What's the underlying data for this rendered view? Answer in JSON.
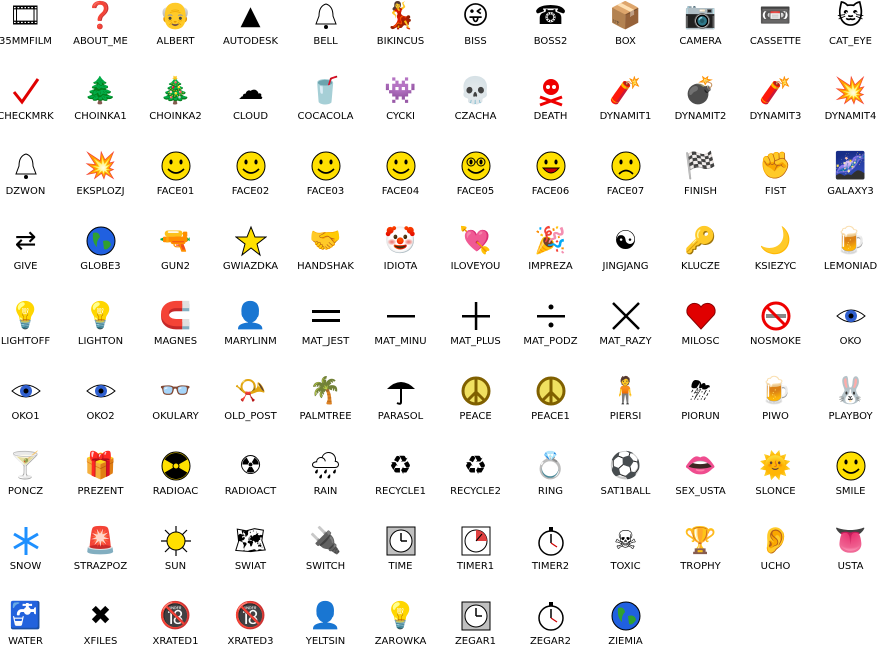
{
  "items": [
    {
      "label": "35MMFILM",
      "icon": "film-canister-icon"
    },
    {
      "label": "ABOUT_ME",
      "icon": "question-mark-icon"
    },
    {
      "label": "ALBERT",
      "icon": "einstein-portrait-icon"
    },
    {
      "label": "AUTODESK",
      "icon": "autodesk-logo-icon"
    },
    {
      "label": "BELL",
      "icon": "bell-icon"
    },
    {
      "label": "BIKINCUS",
      "icon": "bikini-woman-icon"
    },
    {
      "label": "BISS",
      "icon": "cartoon-face-icon"
    },
    {
      "label": "BOSS2",
      "icon": "boss-phone-icon"
    },
    {
      "label": "BOX",
      "icon": "box-icon"
    },
    {
      "label": "CAMERA",
      "icon": "camera-icon"
    },
    {
      "label": "CASSETTE",
      "icon": "cassette-icon"
    },
    {
      "label": "CAT_EYE",
      "icon": "cat-eye-icon"
    },
    {
      "label": "CHECKMRK",
      "icon": "checkmark-icon"
    },
    {
      "label": "CHOINKA1",
      "icon": "christmas-tree-icon"
    },
    {
      "label": "CHOINKA2",
      "icon": "decorated-christmas-tree-icon"
    },
    {
      "label": "CLOUD",
      "icon": "cloud-icon"
    },
    {
      "label": "COCACOLA",
      "icon": "cola-can-icon"
    },
    {
      "label": "CYCKI",
      "icon": "cartoon-creature-icon"
    },
    {
      "label": "CZACHA",
      "icon": "skull-icon"
    },
    {
      "label": "DEATH",
      "icon": "skull-crossbones-icon"
    },
    {
      "label": "DYNAMIT1",
      "icon": "dynamite-icon"
    },
    {
      "label": "DYNAMIT2",
      "icon": "detonator-icon"
    },
    {
      "label": "DYNAMIT3",
      "icon": "dynamite-stick-icon"
    },
    {
      "label": "DYNAMIT4",
      "icon": "dynamite-bundle-icon"
    },
    {
      "label": "DZWON",
      "icon": "bell-icon"
    },
    {
      "label": "EKSPLOZJ",
      "icon": "explosion-icon"
    },
    {
      "label": "FACE01",
      "icon": "smiley-face-icon"
    },
    {
      "label": "FACE02",
      "icon": "smiley-face-icon"
    },
    {
      "label": "FACE03",
      "icon": "smiley-face-icon"
    },
    {
      "label": "FACE04",
      "icon": "smiley-face-icon"
    },
    {
      "label": "FACE05",
      "icon": "glasses-face-icon"
    },
    {
      "label": "FACE06",
      "icon": "laughing-face-icon"
    },
    {
      "label": "FACE07",
      "icon": "sad-face-icon"
    },
    {
      "label": "FINISH",
      "icon": "checkered-flag-icon"
    },
    {
      "label": "FIST",
      "icon": "fist-icon"
    },
    {
      "label": "GALAXY3",
      "icon": "galaxy-icon"
    },
    {
      "label": "GIVE",
      "icon": "give-arrows-icon"
    },
    {
      "label": "GLOBE3",
      "icon": "globe-icon"
    },
    {
      "label": "GUN2",
      "icon": "gun-icon"
    },
    {
      "label": "GWIAZDKA",
      "icon": "star-icon"
    },
    {
      "label": "HANDSHAK",
      "icon": "handshake-icon"
    },
    {
      "label": "IDIOTA",
      "icon": "jester-icon"
    },
    {
      "label": "ILOVEYOU",
      "icon": "heart-arrow-icon"
    },
    {
      "label": "IMPREZA",
      "icon": "party-icon"
    },
    {
      "label": "JINGJANG",
      "icon": "yin-yang-icon"
    },
    {
      "label": "KLUCZE",
      "icon": "keys-icon"
    },
    {
      "label": "KSIEZYC",
      "icon": "moon-icon"
    },
    {
      "label": "LEMONIAD",
      "icon": "lemonade-icon"
    },
    {
      "label": "LIGHTOFF",
      "icon": "lightbulb-off-icon"
    },
    {
      "label": "LIGHTON",
      "icon": "lightbulb-on-icon"
    },
    {
      "label": "MAGNES",
      "icon": "magnet-icon"
    },
    {
      "label": "MARYLINM",
      "icon": "portrait-icon"
    },
    {
      "label": "MAT_JEST",
      "icon": "equals-icon"
    },
    {
      "label": "MAT_MINU",
      "icon": "minus-icon"
    },
    {
      "label": "MAT_PLUS",
      "icon": "plus-icon"
    },
    {
      "label": "MAT_PODZ",
      "icon": "divide-icon"
    },
    {
      "label": "MAT_RAZY",
      "icon": "multiply-icon"
    },
    {
      "label": "MILOSC",
      "icon": "heart-icon"
    },
    {
      "label": "NOSMOKE",
      "icon": "no-smoking-icon"
    },
    {
      "label": "OKO",
      "icon": "eye-icon"
    },
    {
      "label": "OKO1",
      "icon": "eye-icon"
    },
    {
      "label": "OKO2",
      "icon": "eye-icon"
    },
    {
      "label": "OKULARY",
      "icon": "glasses-icon"
    },
    {
      "label": "OLD_POST",
      "icon": "post-horn-icon"
    },
    {
      "label": "PALMTREE",
      "icon": "palm-tree-icon"
    },
    {
      "label": "PARASOL",
      "icon": "umbrella-icon"
    },
    {
      "label": "PEACE",
      "icon": "peace-sign-icon"
    },
    {
      "label": "PEACE1",
      "icon": "peace-sign-icon"
    },
    {
      "label": "PIERSI",
      "icon": "torso-icon"
    },
    {
      "label": "PIORUN",
      "icon": "thunder-cloud-icon"
    },
    {
      "label": "PIWO",
      "icon": "beer-can-icon"
    },
    {
      "label": "PLAYBOY",
      "icon": "bunny-logo-icon"
    },
    {
      "label": "PONCZ",
      "icon": "cocktail-icon"
    },
    {
      "label": "PREZENT",
      "icon": "gift-icon"
    },
    {
      "label": "RADIOAC",
      "icon": "radioactive-icon"
    },
    {
      "label": "RADIOACT",
      "icon": "radioactive-barrel-icon"
    },
    {
      "label": "RAIN",
      "icon": "rain-cloud-icon"
    },
    {
      "label": "RECYCLE1",
      "icon": "recycle-icon"
    },
    {
      "label": "RECYCLE2",
      "icon": "recycle-icon"
    },
    {
      "label": "RING",
      "icon": "ring-icon"
    },
    {
      "label": "SAT1BALL",
      "icon": "ball-icon"
    },
    {
      "label": "SEX_USTA",
      "icon": "lips-icon"
    },
    {
      "label": "SLONCE",
      "icon": "sun-face-icon"
    },
    {
      "label": "SMILE",
      "icon": "smiley-face-icon"
    },
    {
      "label": "SNOW",
      "icon": "snowflake-icon"
    },
    {
      "label": "STRAZPOZ",
      "icon": "siren-icon"
    },
    {
      "label": "SUN",
      "icon": "sun-icon"
    },
    {
      "label": "SWIAT",
      "icon": "world-map-icon"
    },
    {
      "label": "SWITCH",
      "icon": "light-switch-icon"
    },
    {
      "label": "TIME",
      "icon": "clock-icon"
    },
    {
      "label": "TIMER1",
      "icon": "timer-icon"
    },
    {
      "label": "TIMER2",
      "icon": "stopwatch-icon"
    },
    {
      "label": "TOXIC",
      "icon": "toxic-icon"
    },
    {
      "label": "TROPHY",
      "icon": "trophy-icon"
    },
    {
      "label": "UCHO",
      "icon": "ear-icon"
    },
    {
      "label": "USTA",
      "icon": "tongue-lips-icon"
    },
    {
      "label": "WATER",
      "icon": "faucet-icon"
    },
    {
      "label": "XFILES",
      "icon": "xfiles-logo-icon"
    },
    {
      "label": "XRATED1",
      "icon": "xrated-icon"
    },
    {
      "label": "XRATED3",
      "icon": "xrated-icon"
    },
    {
      "label": "YELTSIN",
      "icon": "portrait-icon"
    },
    {
      "label": "ZAROWKA",
      "icon": "lightbulb-icon"
    },
    {
      "label": "ZEGAR1",
      "icon": "clock-icon"
    },
    {
      "label": "ZEGAR2",
      "icon": "stopwatch-icon"
    },
    {
      "label": "ZIEMIA",
      "icon": "globe-icon"
    }
  ]
}
